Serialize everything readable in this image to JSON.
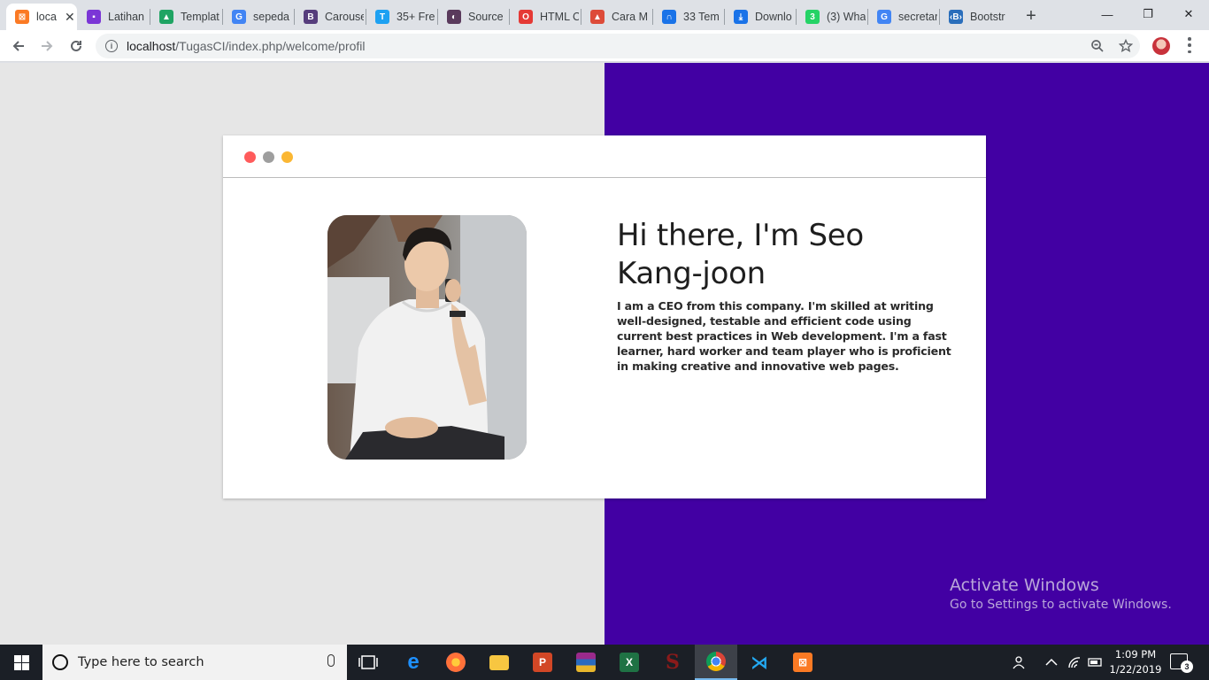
{
  "browser": {
    "tabs": [
      {
        "label": "loca",
        "icon": "xampp-icon",
        "color": "#fb7a24",
        "glyph": "⊠",
        "active": true
      },
      {
        "label": "Latihan",
        "icon": "classroom-icon",
        "color": "#7b36d6",
        "glyph": "▪"
      },
      {
        "label": "Templat",
        "icon": "drive-icon",
        "color": "#1fa463",
        "glyph": "▲"
      },
      {
        "label": "sepeda",
        "icon": "google-icon",
        "color": "#4285f4",
        "glyph": "G"
      },
      {
        "label": "Carouse",
        "icon": "bootstrap-icon",
        "color": "#563d7c",
        "glyph": "B"
      },
      {
        "label": "35+ Fre",
        "icon": "t-icon",
        "color": "#1da1f2",
        "glyph": "T"
      },
      {
        "label": "Source",
        "icon": "source-icon",
        "color": "#5a3a5c",
        "glyph": "◐"
      },
      {
        "label": "HTML C",
        "icon": "opera-icon",
        "color": "#e53935",
        "glyph": "O"
      },
      {
        "label": "Cara M",
        "icon": "angular-icon",
        "color": "#dd4b39",
        "glyph": "▲"
      },
      {
        "label": "33 Tem",
        "icon": "mailchimp-icon",
        "color": "#1a73e8",
        "glyph": "∩"
      },
      {
        "label": "Downlo",
        "icon": "download-icon",
        "color": "#1a73e8",
        "glyph": "⤓"
      },
      {
        "label": "(3) Wha",
        "icon": "whatsapp-icon",
        "color": "#25d366",
        "glyph": "3"
      },
      {
        "label": "secretar",
        "icon": "google-icon",
        "color": "#4285f4",
        "glyph": "G"
      },
      {
        "label": "Bootstr",
        "icon": "bootstrap-icon",
        "color": "#2a6ebb",
        "glyph": "‹B›"
      }
    ],
    "new_tab": "+",
    "window_controls": {
      "minimize": "—",
      "maximize": "❐",
      "close": "✕"
    },
    "url_host": "localhost",
    "url_path": "/TugasCI/index.php/welcome/profil"
  },
  "page": {
    "heading": "Hi there, I'm Seo Kang-joon",
    "bio": "I am a CEO from this company. I'm skilled at writing well-designed, testable and efficient code using current best practices in Web development. I'm a fast learner, hard worker and team player who is proficient in making creative and innovative web pages.",
    "window_dots": [
      "#ff5b5b",
      "#9e9e9e",
      "#fbb733"
    ],
    "accent_color": "#4200a3"
  },
  "watermark": {
    "line1": "Activate Windows",
    "line2": "Go to Settings to activate Windows."
  },
  "taskbar": {
    "search_placeholder": "Type here to search",
    "time": "1:09 PM",
    "date": "1/22/2019",
    "notification_count": "3"
  }
}
